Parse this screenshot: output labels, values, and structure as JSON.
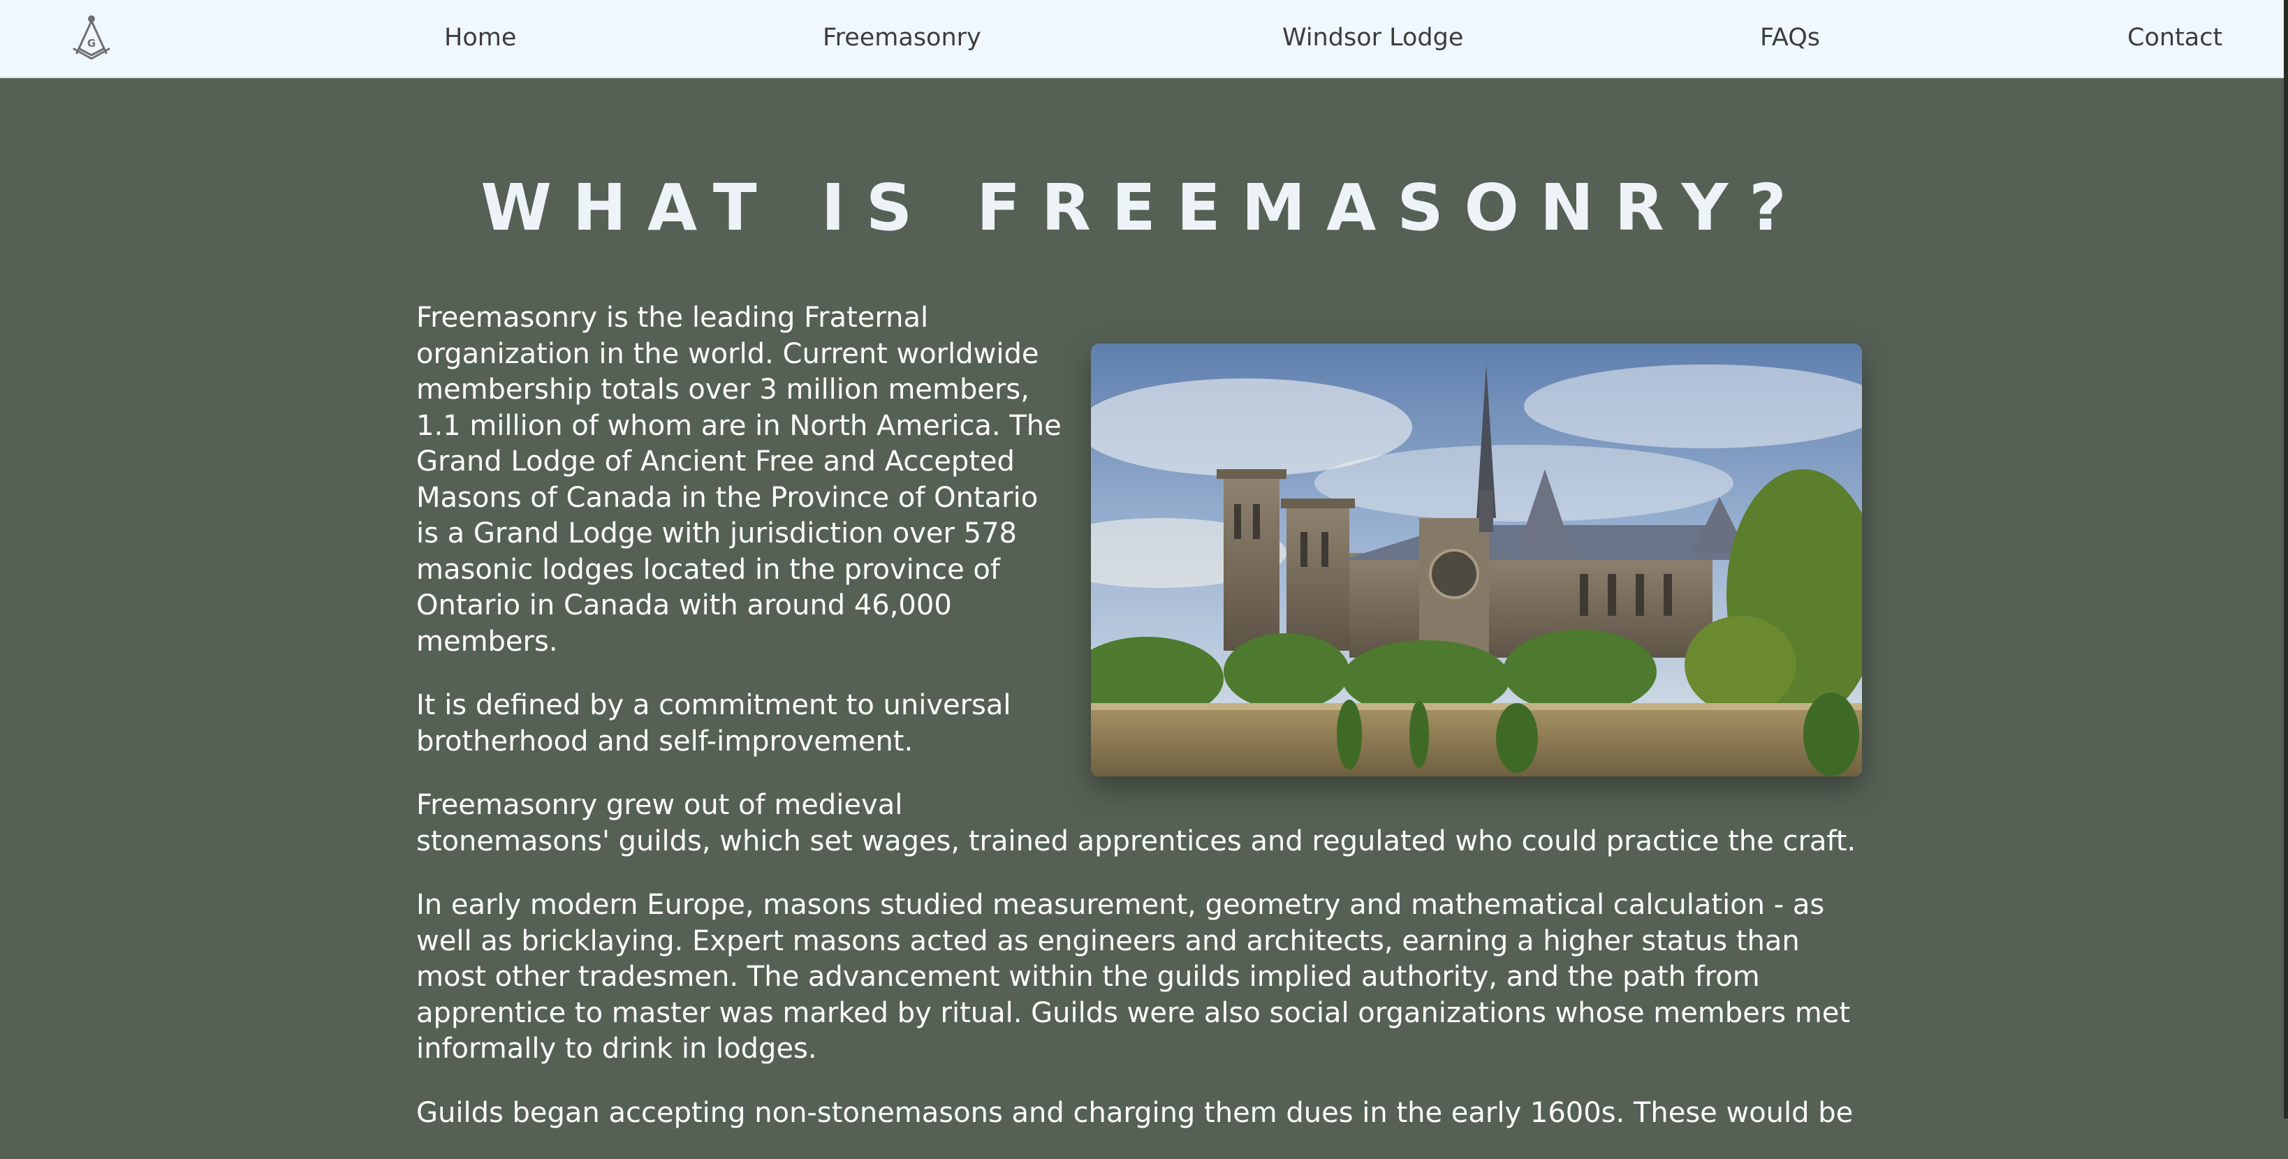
{
  "nav": {
    "logo_icon": "square-and-compass-icon",
    "links": [
      {
        "label": "Home"
      },
      {
        "label": "Freemasonry"
      },
      {
        "label": "Windsor Lodge"
      },
      {
        "label": "FAQs"
      },
      {
        "label": "Contact"
      }
    ]
  },
  "page": {
    "title": "WHAT IS FREEMASONRY?",
    "image_subject": "cathedral-photo",
    "paragraphs": [
      "Freemasonry is the leading Fraternal organization in the world. Current worldwide membership totals over 3 million members, 1.1 million of whom are in North America. The Grand Lodge of Ancient Free and Accepted Masons of Canada in the Province of Ontario is a Grand Lodge with jurisdiction over 578 masonic lodges located in the province of Ontario in Canada with around 46,000 members.",
      "It is defined by a commitment to universal brotherhood and self-improvement.",
      "Freemasonry grew out of medieval stonemasons' guilds, which set wages, trained apprentices and regulated who could practice the craft.",
      "In early modern Europe, masons studied measurement, geometry and mathematical calculation - as well as bricklaying. Expert masons acted as engineers and architects, earning a higher status than most other tradesmen. The advancement within the guilds implied authority, and the path from apprentice to master was marked by ritual. Guilds were also social organizations whose members met informally to drink in lodges.",
      "Guilds began accepting non-stonemasons and charging them dues in the early 1600s. These would be"
    ]
  },
  "colors": {
    "background": "#566155",
    "navbar": "#f0f8ff",
    "nav_text": "#3d3d3d",
    "text": "#ffffff"
  }
}
